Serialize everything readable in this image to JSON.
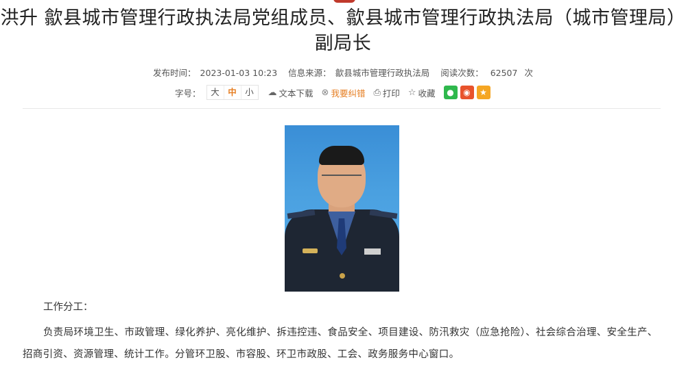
{
  "article": {
    "title_line1": "洪升 歙县城市管理行政执法局党组成员、歙县城市管理行政执法局（城市管理局）",
    "title_line2": "副局长",
    "publish_label": "发布时间：",
    "publish_time": "2023-01-03 10:23",
    "source_label": "信息来源：",
    "source": "歙县城市管理行政执法局",
    "views_label": "阅读次数：",
    "views": "62507",
    "views_unit": "次"
  },
  "toolbar": {
    "font_size_label": "字号：",
    "font_large": "大",
    "font_medium": "中",
    "font_small": "小",
    "download_label": "文本下载",
    "correct_label": "我要纠错",
    "print_label": "打印",
    "favorite_label": "收藏"
  },
  "content": {
    "section_title": "工作分工：",
    "duties": "负责局环境卫生、市政管理、绿化养护、亮化维护、拆违控违、食品安全、项目建设、防汛救灾（应急抢险）、社会综合治理、安全生产、招商引资、资源管理、统计工作。分管环卫股、市容股、环卫市政股、工会、政务服务中心窗口。"
  },
  "icons": {
    "download": "cloud-download-icon",
    "correct": "error-circle-icon",
    "print": "printer-icon",
    "favorite": "star-outline-icon",
    "share_wechat": "wechat-icon",
    "share_weibo": "weibo-icon",
    "share_fav": "star-icon"
  }
}
